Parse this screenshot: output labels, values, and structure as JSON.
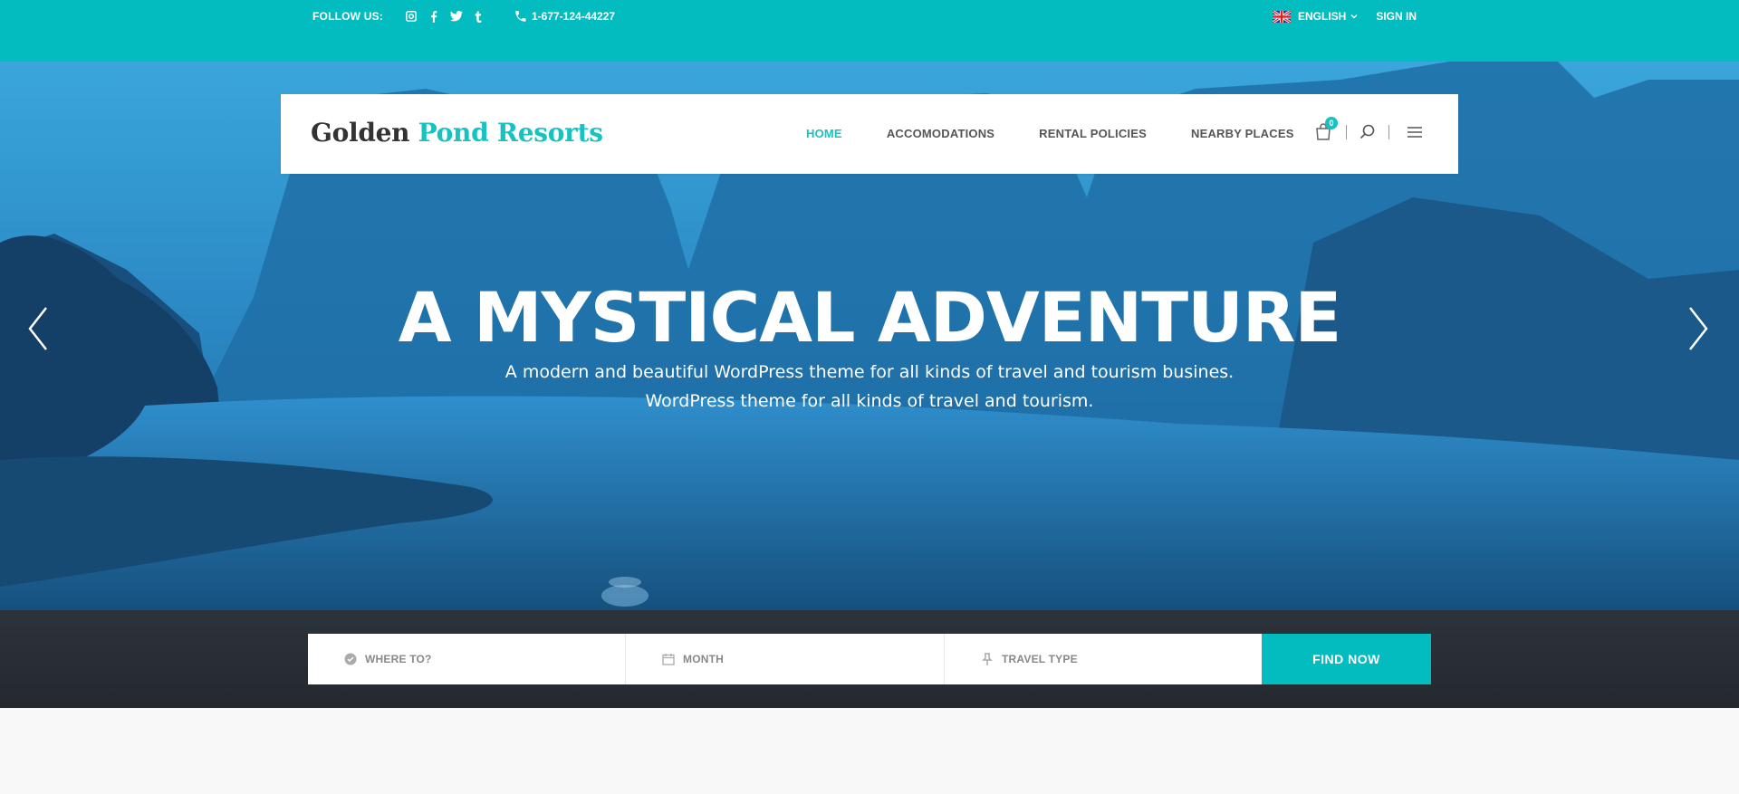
{
  "topbar": {
    "follow_label": "FOLLOW US:",
    "social_icons": [
      "instagram-icon",
      "facebook-icon",
      "twitter-icon",
      "tumblr-icon"
    ],
    "phone": "1-677-124-44227",
    "language": "ENGLISH",
    "sign_in": "SIGN IN",
    "bg_color": "#02bcbf"
  },
  "header": {
    "logo_part1": "Golden",
    "logo_part2": "Pond Resorts",
    "nav": [
      "HOME",
      "ACCOMODATIONS",
      "RENTAL POLICIES",
      "NEARBY PLACES"
    ],
    "active_nav": "HOME",
    "cart_count": "0",
    "accent_color": "#17c2c3"
  },
  "hero": {
    "title": "A MYSTICAL ADVENTURE",
    "subtitle_line1": "A modern and beautiful WordPress theme for all kinds of travel and tourism busines.",
    "subtitle_line2": "WordPress theme for all kinds of travel and tourism."
  },
  "search": {
    "where_placeholder": "WHERE TO?",
    "month_placeholder": "MONTH",
    "travel_type_placeholder": "TRAVEL TYPE",
    "button": "FIND NOW"
  }
}
